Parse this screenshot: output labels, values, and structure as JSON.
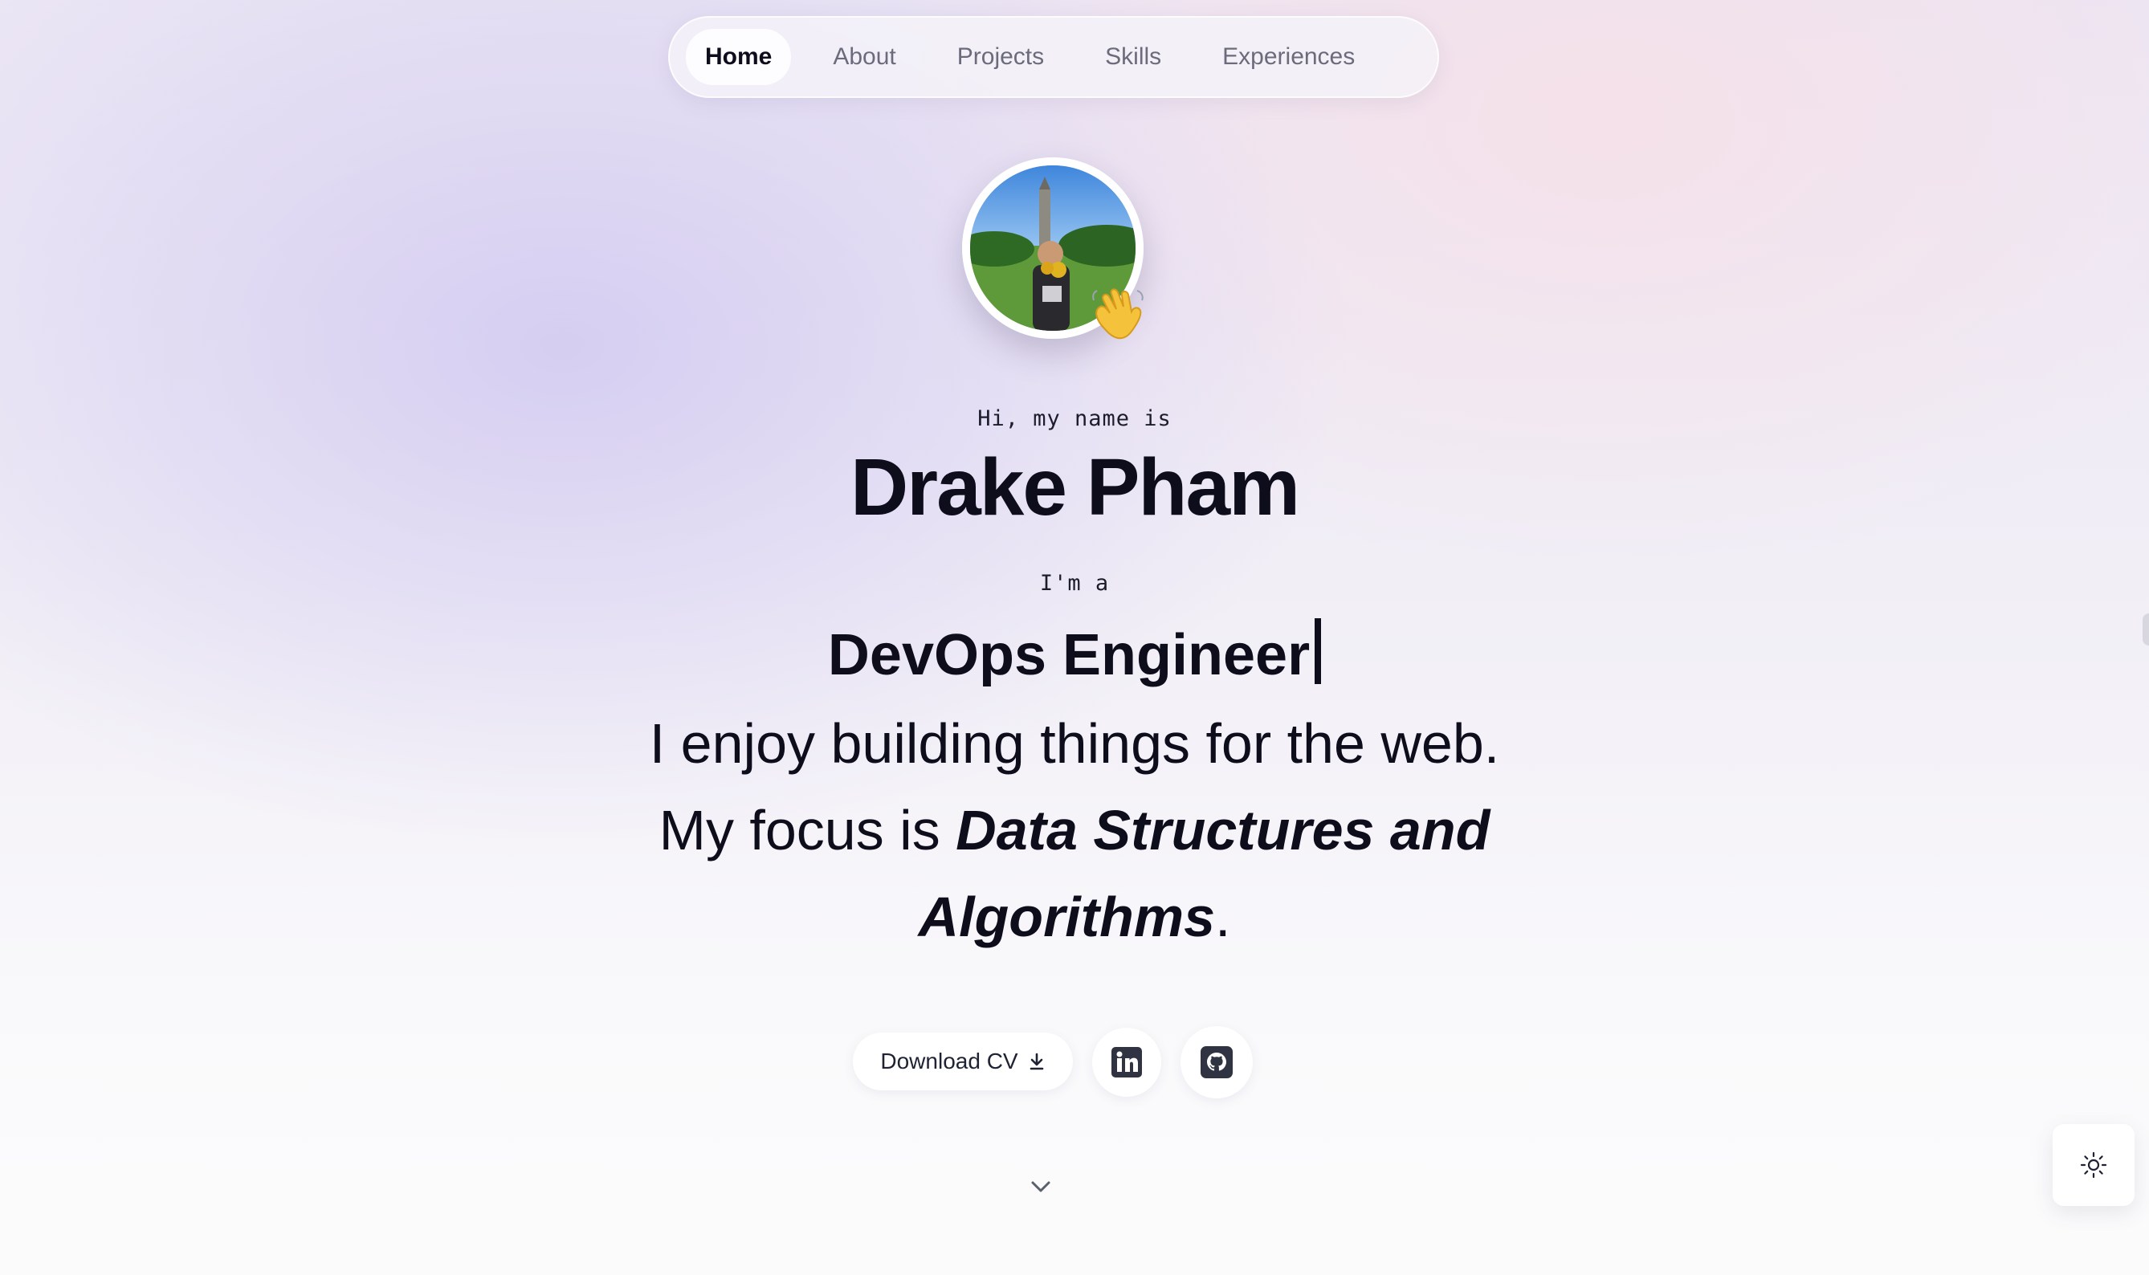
{
  "nav": {
    "items": [
      {
        "label": "Home",
        "active": true
      },
      {
        "label": "About",
        "active": false
      },
      {
        "label": "Projects",
        "active": false
      },
      {
        "label": "Skills",
        "active": false
      },
      {
        "label": "Experiences",
        "active": false
      }
    ]
  },
  "hero": {
    "greeting": "Hi, my name is",
    "name": "Drake Pham",
    "role_intro": "I'm a",
    "role": "DevOps Engineer",
    "tagline_line1": "I enjoy building things for the web.",
    "tagline_prefix": "My focus is ",
    "tagline_focus_1": "Data Structures and",
    "tagline_focus_2": "Algorithms",
    "tagline_suffix": "."
  },
  "actions": {
    "download_cv_label": "Download CV",
    "download_icon": "download-icon",
    "linkedin_icon": "linkedin-icon",
    "github_icon": "github-icon"
  },
  "scroll_icon": "chevron-down-icon",
  "theme_icon": "sun-icon",
  "colors": {
    "text": "#0d0d1c",
    "nav_inactive": "#6b6b7b",
    "button_bg": "#ffffff",
    "icon_dark": "#2f3342"
  }
}
